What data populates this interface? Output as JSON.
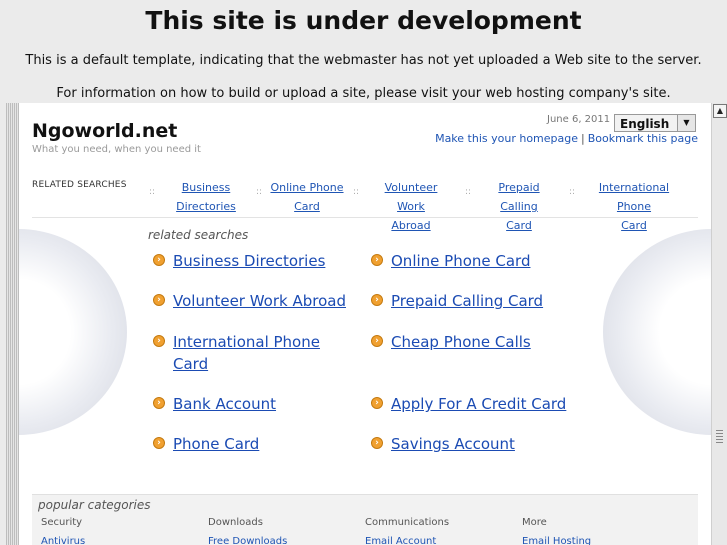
{
  "heading": "This site is under development",
  "line1": "This is a default template, indicating that the webmaster has not yet uploaded a Web site to the server.",
  "line2": "For information on how to build or upload a site, please visit your web hosting company's site.",
  "site": {
    "name": "Ngoworld.net",
    "tagline": "What you need, when you need it",
    "date": "June 6, 2011",
    "language": "English",
    "make_homepage": "Make this your homepage",
    "separator": "|",
    "bookmark": "Bookmark this page"
  },
  "related_label": "RELATED SEARCHES",
  "top_nav": [
    {
      "line1": "Business",
      "line2": "Directories"
    },
    {
      "line1": "Online Phone",
      "line2": "Card"
    },
    {
      "line1": "Volunteer Work",
      "line2": "Abroad"
    },
    {
      "line1": "Prepaid Calling",
      "line2": "Card"
    },
    {
      "line1": "International Phone",
      "line2": "Card"
    }
  ],
  "nav_separator": "::",
  "related_heading": "related searches",
  "results": [
    "Business Directories",
    "Online Phone Card",
    "Volunteer Work Abroad",
    "Prepaid Calling Card",
    "International Phone",
    "Card",
    "Cheap Phone Calls",
    "Bank Account",
    "Apply For A Credit Card",
    "Phone Card",
    "Savings Account"
  ],
  "popular": {
    "title": "popular categories",
    "columns": [
      {
        "head": "Security",
        "link": "Antivirus"
      },
      {
        "head": "Downloads",
        "link": "Free Downloads"
      },
      {
        "head": "Communications",
        "link": "Email Account"
      },
      {
        "head": "More",
        "link": "Email Hosting"
      }
    ]
  }
}
